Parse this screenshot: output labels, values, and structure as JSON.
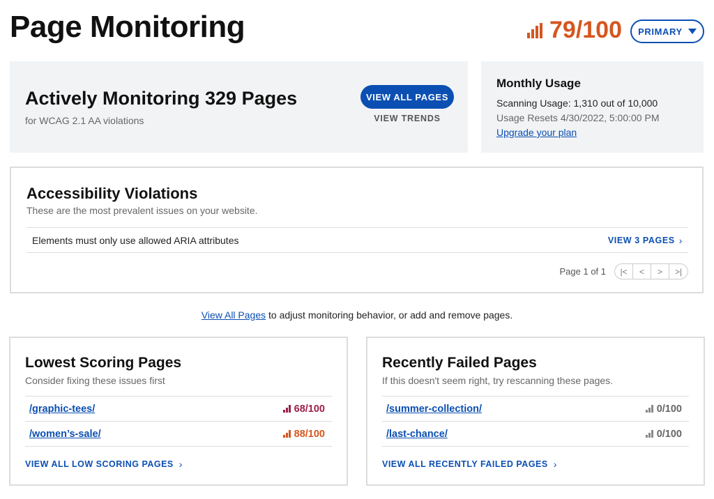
{
  "header": {
    "title": "Page Monitoring",
    "score": "79/100",
    "score_icon": "bar-chart-icon",
    "primary_button": "PRIMARY"
  },
  "monitor": {
    "title": "Actively Monitoring 329 Pages",
    "subtitle": "for WCAG 2.1 AA violations",
    "view_all_pages": "VIEW ALL PAGES",
    "view_trends": "VIEW TRENDS"
  },
  "usage": {
    "title": "Monthly Usage",
    "scanning": "Scanning Usage: 1,310 out of 10,000",
    "resets": "Usage Resets 4/30/2022, 5:00:00 PM",
    "upgrade": "Upgrade your plan"
  },
  "violations": {
    "title": "Accessibility Violations",
    "subtitle": "These are the most prevalent issues on your website.",
    "rows": [
      {
        "text": "Elements must only use allowed ARIA attributes",
        "link": "VIEW 3 PAGES"
      }
    ],
    "pager_label": "Page 1 of 1",
    "pager_first": "|<",
    "pager_prev": "<",
    "pager_next": ">",
    "pager_last": ">|"
  },
  "info": {
    "link": "View All Pages",
    "text": " to adjust monitoring behavior, or add and remove pages."
  },
  "lowest": {
    "title": "Lowest Scoring Pages",
    "subtitle": "Consider fixing these issues first",
    "rows": [
      {
        "page": "/graphic-tees/",
        "score": "68/100",
        "color": "#9b1f4a"
      },
      {
        "page": "/women’s-sale/",
        "score": "88/100",
        "color": "#d5561f"
      }
    ],
    "footer": "VIEW ALL LOW SCORING PAGES"
  },
  "failed": {
    "title": "Recently Failed Pages",
    "subtitle": "If this doesn't seem right, try rescanning these pages.",
    "rows": [
      {
        "page": "/summer-collection/",
        "score": "0/100",
        "color": "#666666"
      },
      {
        "page": "/last-chance/",
        "score": "0/100",
        "color": "#666666"
      }
    ],
    "footer": "VIEW ALL RECENTLY FAILED PAGES"
  },
  "colors": {
    "accent": "#0b4fb3",
    "score_orange": "#d5561f",
    "card_bg": "#f1f3f5"
  }
}
